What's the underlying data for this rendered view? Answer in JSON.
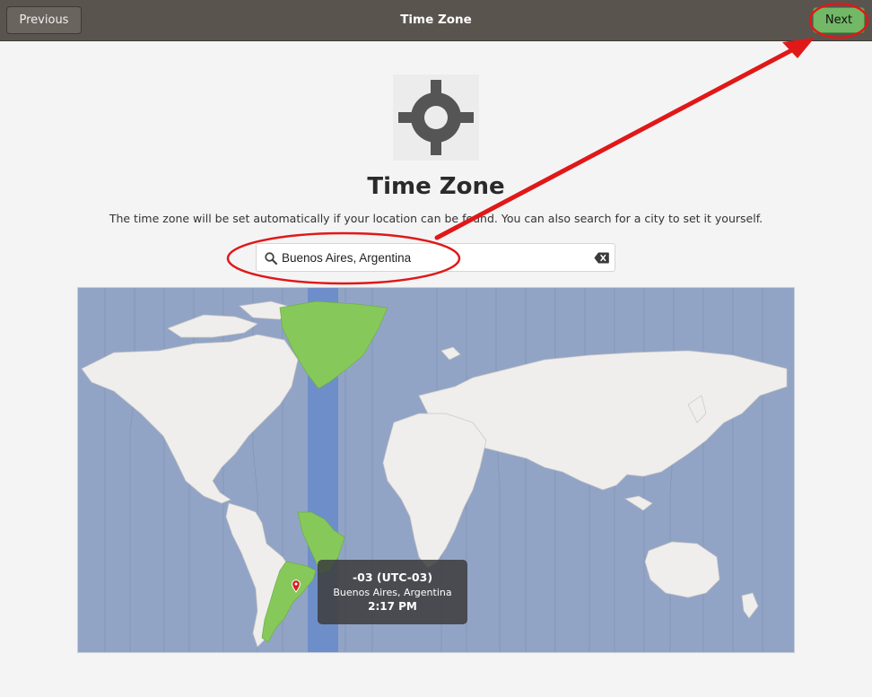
{
  "header": {
    "title": "Time Zone",
    "previous_label": "Previous",
    "next_label": "Next"
  },
  "hero": {
    "icon": "locate-icon",
    "title": "Time Zone",
    "description": "The time zone will be set automatically if your location can be found. You can also search for a city to set it yourself."
  },
  "search": {
    "value": "Buenos Aires, Argentina",
    "icon": "search-icon",
    "clear_icon": "clear-icon"
  },
  "map": {
    "selected_zone": "-03 (UTC-03)",
    "city": "Buenos Aires, Argentina",
    "time": "2:17 PM",
    "pin_icon": "map-pin-icon"
  },
  "colors": {
    "header_bg": "#5a544e",
    "next_button": "#72b866",
    "ocean": "#92a4c6",
    "land": "#efeeec",
    "highlight_zone": "#6e8ec9",
    "highlight_land": "#86c95a",
    "annotation": "#e01818"
  }
}
